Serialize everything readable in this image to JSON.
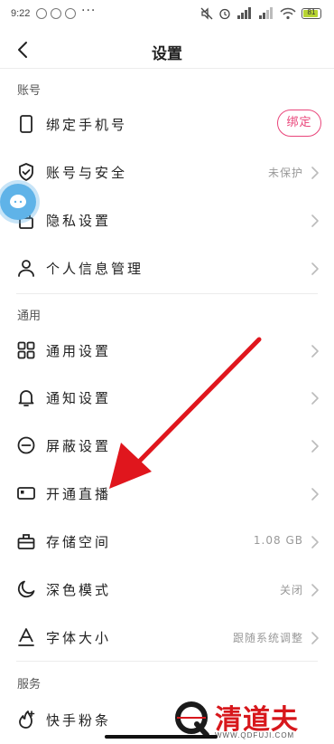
{
  "status_bar": {
    "time": "9:22",
    "more": "···",
    "battery": "81"
  },
  "header": {
    "title": "设置"
  },
  "sections": {
    "account": "账号",
    "general": "通用",
    "services": "服务"
  },
  "rows": {
    "bind_phone": {
      "label": "绑定手机号",
      "button": "绑定"
    },
    "account_security": {
      "label": "账号与安全",
      "value": "未保护"
    },
    "privacy": {
      "label": "隐私设置"
    },
    "personal_info": {
      "label": "个人信息管理"
    },
    "general_settings": {
      "label": "通用设置"
    },
    "notifications": {
      "label": "通知设置"
    },
    "blocking": {
      "label": "屏蔽设置"
    },
    "live": {
      "label": "开通直播"
    },
    "storage": {
      "label": "存储空间",
      "value": "1.08 GB"
    },
    "dark_mode": {
      "label": "深色模式",
      "value": "关闭"
    },
    "font_size": {
      "label": "字体大小",
      "value": "跟随系统调整"
    },
    "fans": {
      "label": "快手粉条"
    }
  },
  "watermark": {
    "main": "清道夫",
    "sub": "WWW.QDFUJI.COM"
  },
  "colors": {
    "accent": "#e9457a",
    "arrow": "#e0161d",
    "avatar": "#5fb3e8"
  }
}
